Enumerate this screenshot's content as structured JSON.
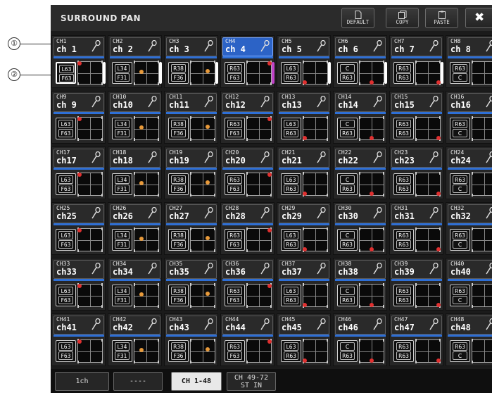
{
  "window": {
    "title": "SURROUND PAN",
    "buttons": {
      "default": "DEFAULT",
      "copy": "COPY",
      "paste": "PASTE",
      "close": "✖"
    }
  },
  "callouts": [
    "①",
    "②"
  ],
  "patterns": {
    "A": {
      "l1": "L63",
      "l2": "F63",
      "dot": "#e03030",
      "dx": 0.05,
      "dy": 0.08
    },
    "B": {
      "l1": "L34",
      "l2": "F31",
      "dot": "#e89a3a",
      "dx": 0.28,
      "dy": 0.45
    },
    "C": {
      "l1": "R38",
      "l2": "F36",
      "dot": "#e89a3a",
      "dx": 0.72,
      "dy": 0.42
    },
    "D": {
      "l1": "R63",
      "l2": "F63",
      "dot": "#e03030",
      "dx": 0.95,
      "dy": 0.08
    },
    "E": {
      "l1": "L63",
      "l2": "R63",
      "dot": "#e03030",
      "dx": 0.05,
      "dy": 0.92
    },
    "F": {
      "l1": "C",
      "l2": "R63",
      "dot": "#e03030",
      "dx": 0.5,
      "dy": 0.92
    },
    "G": {
      "l1": "R63",
      "l2": "R63",
      "dot": "#e03030",
      "dx": 0.95,
      "dy": 0.92
    },
    "H": {
      "l1": "R63",
      "l2": "C",
      "dot": "#e03030",
      "dx": 0.95,
      "dy": 0.5
    }
  },
  "channels": [
    {
      "short": "CH1",
      "name": "ch 1",
      "p": "A",
      "sel": false,
      "boxsel": true,
      "bar": "#ffffff"
    },
    {
      "short": "CH2",
      "name": "ch 2",
      "p": "B",
      "sel": false,
      "bar": "#ffffff"
    },
    {
      "short": "CH3",
      "name": "ch 3",
      "p": "C",
      "sel": false,
      "bar": "#ffffff"
    },
    {
      "short": "CH4",
      "name": "ch 4",
      "p": "D",
      "sel": true,
      "bar": "#c044c8"
    },
    {
      "short": "CH5",
      "name": "ch 5",
      "p": "E",
      "sel": false,
      "bar": "#ffffff"
    },
    {
      "short": "CH6",
      "name": "ch 6",
      "p": "F",
      "sel": false,
      "bar": "#ffffff"
    },
    {
      "short": "CH7",
      "name": "ch 7",
      "p": "G",
      "sel": false,
      "bar": "#ffffff"
    },
    {
      "short": "CH8",
      "name": "ch 8",
      "p": "H",
      "sel": false,
      "bar": "#ffffff"
    },
    {
      "short": "CH9",
      "name": "ch 9",
      "p": "A"
    },
    {
      "short": "CH10",
      "name": "ch10",
      "p": "B"
    },
    {
      "short": "CH11",
      "name": "ch11",
      "p": "C"
    },
    {
      "short": "CH12",
      "name": "ch12",
      "p": "D"
    },
    {
      "short": "CH13",
      "name": "ch13",
      "p": "E"
    },
    {
      "short": "CH14",
      "name": "ch14",
      "p": "F"
    },
    {
      "short": "CH15",
      "name": "ch15",
      "p": "G"
    },
    {
      "short": "CH16",
      "name": "ch16",
      "p": "H"
    },
    {
      "short": "CH17",
      "name": "ch17",
      "p": "A"
    },
    {
      "short": "CH18",
      "name": "ch18",
      "p": "B"
    },
    {
      "short": "CH19",
      "name": "ch19",
      "p": "C"
    },
    {
      "short": "CH20",
      "name": "ch20",
      "p": "D"
    },
    {
      "short": "CH21",
      "name": "ch21",
      "p": "E"
    },
    {
      "short": "CH22",
      "name": "ch22",
      "p": "F"
    },
    {
      "short": "CH23",
      "name": "ch23",
      "p": "G"
    },
    {
      "short": "CH24",
      "name": "ch24",
      "p": "H"
    },
    {
      "short": "CH25",
      "name": "ch25",
      "p": "A"
    },
    {
      "short": "CH26",
      "name": "ch26",
      "p": "B"
    },
    {
      "short": "CH27",
      "name": "ch27",
      "p": "C"
    },
    {
      "short": "CH28",
      "name": "ch28",
      "p": "D"
    },
    {
      "short": "CH29",
      "name": "ch29",
      "p": "E"
    },
    {
      "short": "CH30",
      "name": "ch30",
      "p": "F"
    },
    {
      "short": "CH31",
      "name": "ch31",
      "p": "G"
    },
    {
      "short": "CH32",
      "name": "ch32",
      "p": "H"
    },
    {
      "short": "CH33",
      "name": "ch33",
      "p": "A"
    },
    {
      "short": "CH34",
      "name": "ch34",
      "p": "B"
    },
    {
      "short": "CH35",
      "name": "ch35",
      "p": "C"
    },
    {
      "short": "CH36",
      "name": "ch36",
      "p": "D"
    },
    {
      "short": "CH37",
      "name": "ch37",
      "p": "E"
    },
    {
      "short": "CH38",
      "name": "ch38",
      "p": "F"
    },
    {
      "short": "CH39",
      "name": "ch39",
      "p": "G"
    },
    {
      "short": "CH40",
      "name": "ch40",
      "p": "H"
    },
    {
      "short": "CH41",
      "name": "ch41",
      "p": "A"
    },
    {
      "short": "CH42",
      "name": "ch42",
      "p": "B"
    },
    {
      "short": "CH43",
      "name": "ch43",
      "p": "C"
    },
    {
      "short": "CH44",
      "name": "ch44",
      "p": "D"
    },
    {
      "short": "CH45",
      "name": "ch45",
      "p": "E"
    },
    {
      "short": "CH46",
      "name": "ch46",
      "p": "F"
    },
    {
      "short": "CH47",
      "name": "ch47",
      "p": "G"
    },
    {
      "short": "CH48",
      "name": "ch48",
      "p": "H"
    }
  ],
  "bottom_tabs": [
    {
      "label": "1ch",
      "active": false
    },
    {
      "label": "----",
      "active": false
    },
    {
      "label": "CH 1-48",
      "active": true
    },
    {
      "label": "CH 49-72\nST IN",
      "active": false
    }
  ]
}
